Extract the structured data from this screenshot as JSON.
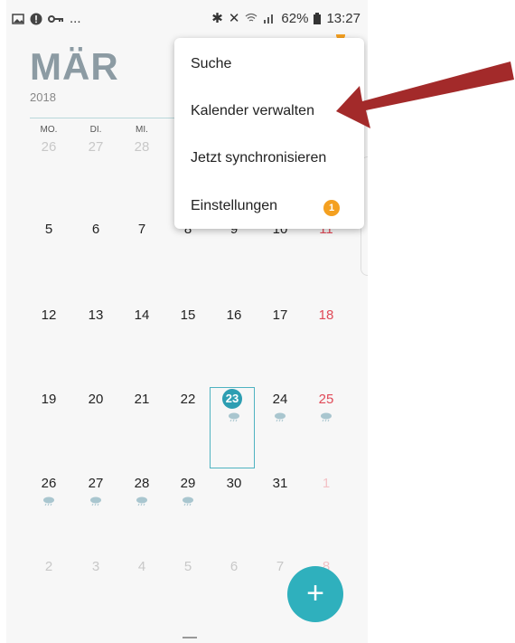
{
  "status_bar": {
    "left_icons": [
      "image-icon",
      "alert-icon",
      "key-icon"
    ],
    "left_more": "...",
    "right_icons": [
      "bluetooth-icon",
      "mute-icon",
      "wifi-icon",
      "signal-icon"
    ],
    "battery": "62%",
    "time": "13:27"
  },
  "calendar": {
    "month": "MÄR",
    "year": "2018",
    "weekdays": [
      "MO.",
      "DI.",
      "MI."
    ],
    "rows": [
      [
        "26",
        "27",
        "28",
        "",
        "",
        "",
        ""
      ],
      [
        "5",
        "6",
        "7",
        "8",
        "9",
        "10",
        "11"
      ],
      [
        "12",
        "13",
        "14",
        "15",
        "16",
        "17",
        "18"
      ],
      [
        "19",
        "20",
        "21",
        "22",
        "23",
        "24",
        "25"
      ],
      [
        "26",
        "27",
        "28",
        "29",
        "30",
        "31",
        "1"
      ],
      [
        "2",
        "3",
        "4",
        "5",
        "6",
        "7",
        "8"
      ]
    ],
    "today": "23"
  },
  "menu": {
    "items": [
      "Suche",
      "Kalender verwalten",
      "Jetzt synchronisieren",
      "Einstellungen"
    ],
    "badge": "1"
  },
  "fab_label": "+",
  "colors": {
    "accent": "#2fb0bd",
    "sunday": "#e04a58",
    "badge": "#f4a020",
    "arrow": "#a32a2a"
  }
}
